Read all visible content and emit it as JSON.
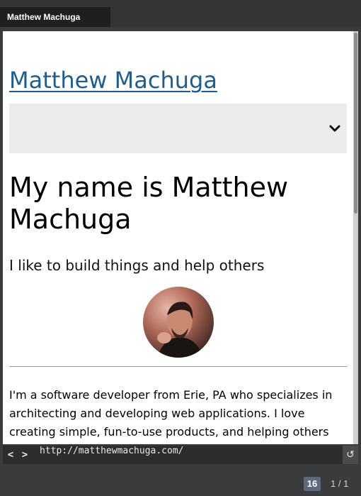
{
  "tab": {
    "title": "Matthew Machuga"
  },
  "site": {
    "title": "Matthew Machuga",
    "menu_icon": "chevron-down-icon",
    "hero_title": "My name is Matthew Machuga",
    "hero_subtitle": "I like to build things and help others",
    "bio": "I'm a software developer from Erie, PA who specializes in architecting and developing web applications. I love creating simple, fun-to-use products, and helping others achieve their goals."
  },
  "browser": {
    "back_label": "<",
    "forward_label": ">",
    "url": "http://matthewmachuga.com/",
    "reload_icon": "reload-icon"
  },
  "status": {
    "zoom": "16",
    "page_count": "1 / 1"
  },
  "colors": {
    "link": "#1f5d8c",
    "nav_bg": "#ececec",
    "chrome": "#3a3b3d"
  }
}
